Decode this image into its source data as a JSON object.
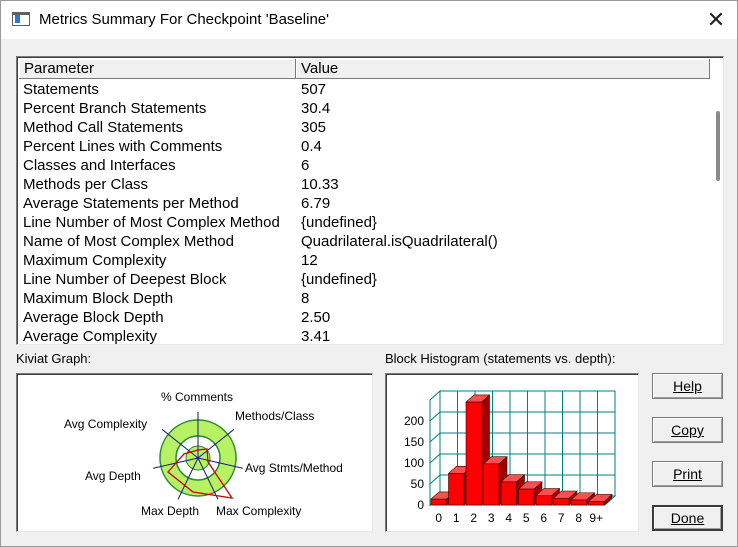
{
  "window": {
    "title": "Metrics Summary For Checkpoint 'Baseline'"
  },
  "table": {
    "headers": {
      "parameter": "Parameter",
      "value": "Value"
    },
    "rows": [
      {
        "p": "Statements",
        "v": "507"
      },
      {
        "p": "Percent Branch Statements",
        "v": "30.4"
      },
      {
        "p": "Method Call Statements",
        "v": "305"
      },
      {
        "p": "Percent Lines with Comments",
        "v": "0.4"
      },
      {
        "p": "Classes and Interfaces",
        "v": "6"
      },
      {
        "p": "Methods per Class",
        "v": "10.33"
      },
      {
        "p": "Average Statements per Method",
        "v": "6.79"
      },
      {
        "p": "Line Number of Most Complex Method",
        "v": "{undefined}"
      },
      {
        "p": "Name of Most Complex Method",
        "v": "Quadrilateral.isQuadrilateral()"
      },
      {
        "p": "Maximum Complexity",
        "v": "12"
      },
      {
        "p": "Line Number of Deepest Block",
        "v": "{undefined}"
      },
      {
        "p": "Maximum Block Depth",
        "v": "8"
      },
      {
        "p": "Average Block Depth",
        "v": "2.50"
      },
      {
        "p": "Average Complexity",
        "v": "3.41"
      }
    ]
  },
  "kiviat": {
    "label": "Kiviat Graph:",
    "axes": [
      "% Comments",
      "Methods/Class",
      "Avg Stmts/Method",
      "Max Complexity",
      "Max Depth",
      "Avg Depth",
      "Avg Complexity"
    ]
  },
  "histogram": {
    "label": "Block Histogram (statements vs. depth):"
  },
  "chart_data": {
    "type": "bar",
    "title": "Block Histogram (statements vs. depth):",
    "categories": [
      "0",
      "1",
      "2",
      "3",
      "4",
      "5",
      "6",
      "7",
      "8",
      "9+"
    ],
    "values": [
      14,
      75,
      245,
      98,
      55,
      38,
      22,
      16,
      12,
      8
    ],
    "yticks": [
      0,
      50,
      100,
      150,
      200
    ],
    "ylim": [
      0,
      250
    ],
    "colors": {
      "bar": "#ff0000",
      "grid": "#008080"
    }
  },
  "buttons": {
    "help": "Help",
    "copy": "Copy",
    "print": "Print",
    "done": "Done"
  },
  "colors": {
    "accent": "#ff0000",
    "kiviat_fill": "#b6f264",
    "kiviat_ring": "#2e8b2e"
  }
}
